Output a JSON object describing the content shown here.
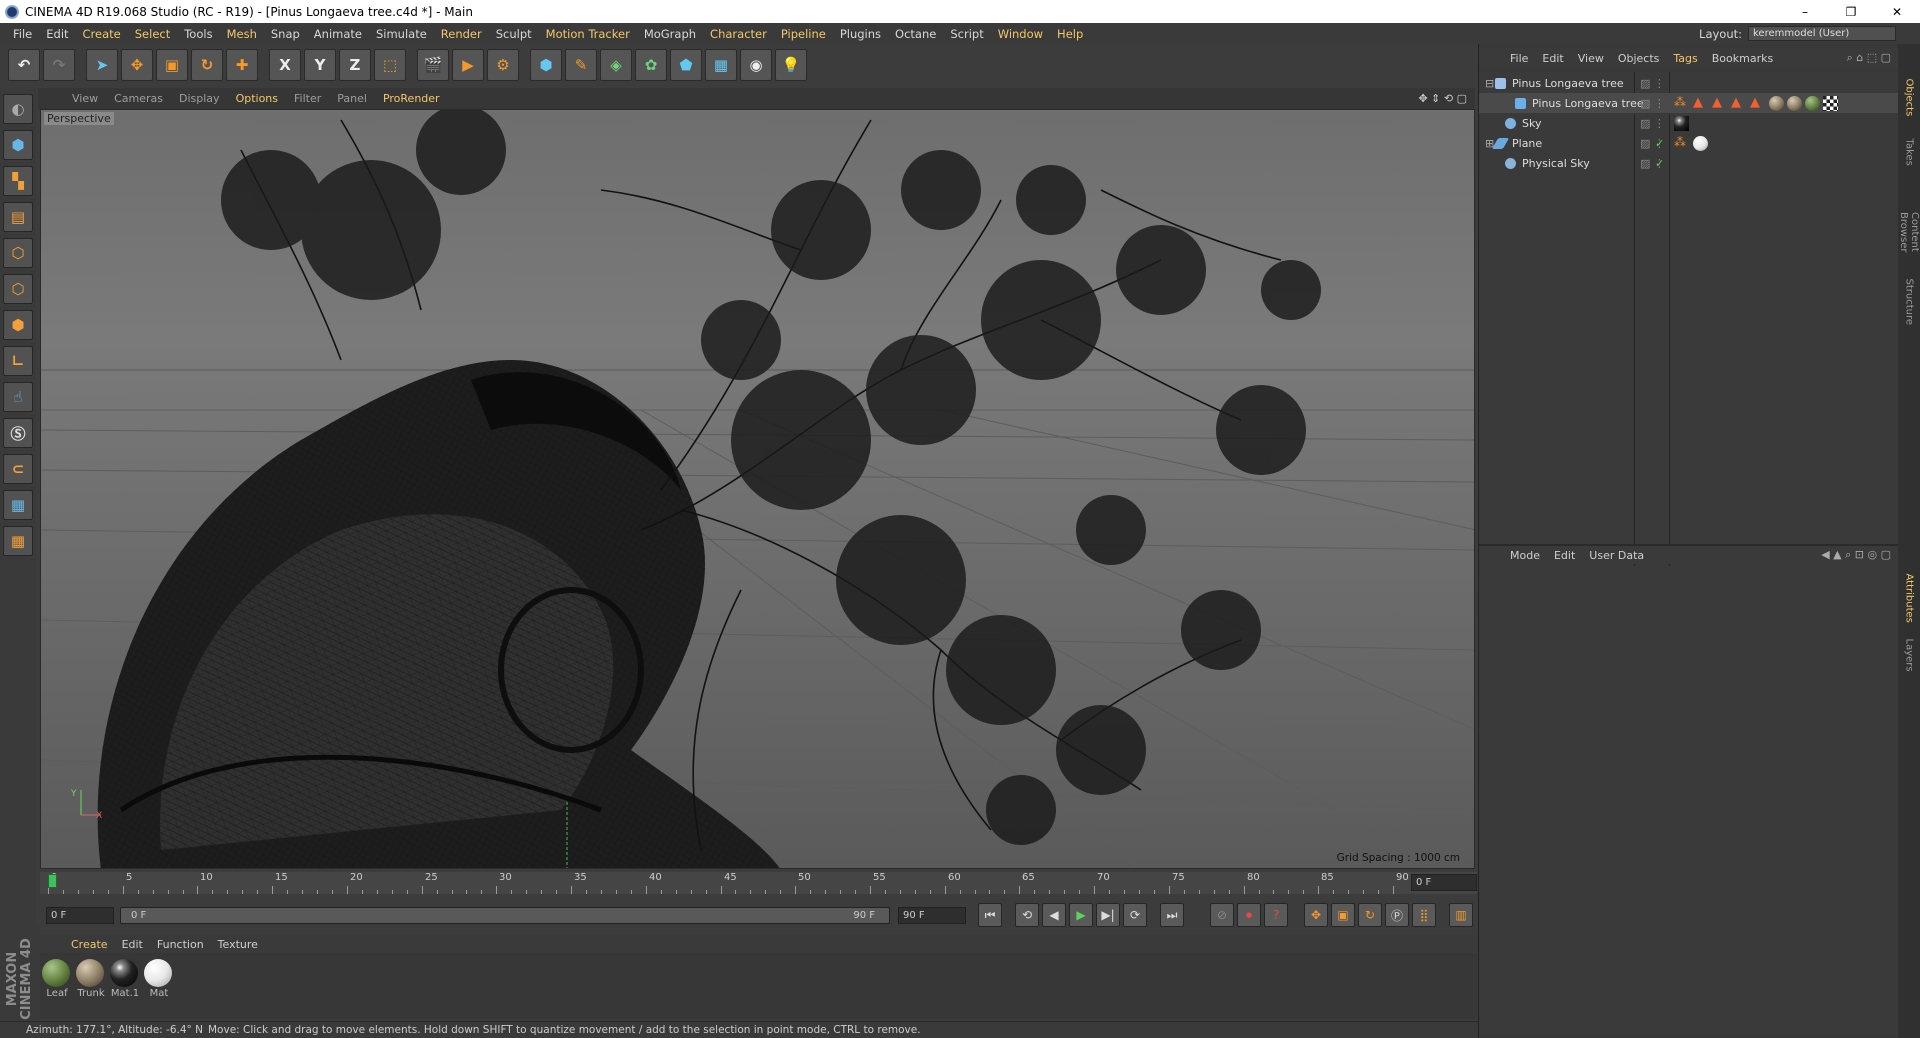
{
  "window": {
    "title": "CINEMA 4D R19.068 Studio (RC - R19) - [Pinus Longaeva tree.c4d *] - Main",
    "minimize": "–",
    "maximize": "❐",
    "close": "✕"
  },
  "menubar": {
    "items": [
      "File",
      "Edit",
      "Create",
      "Select",
      "Tools",
      "Mesh",
      "Snap",
      "Animate",
      "Simulate",
      "Render",
      "Sculpt",
      "Motion Tracker",
      "MoGraph",
      "Character",
      "Pipeline",
      "Plugins",
      "Octane",
      "Script",
      "Window",
      "Help"
    ],
    "layout_label": "Layout:",
    "layout_value": "keremmodel (User)"
  },
  "toolbar": {
    "undo": "↶",
    "redo": "↷",
    "axis_x": "X",
    "axis_y": "Y",
    "axis_z": "Z"
  },
  "viewport": {
    "menu": [
      "View",
      "Cameras",
      "Display",
      "Options",
      "Filter",
      "Panel",
      "ProRender"
    ],
    "label": "Perspective",
    "grid_spacing": "Grid Spacing : 1000 cm"
  },
  "timeline": {
    "ticks": [
      "0",
      "5",
      "10",
      "15",
      "20",
      "25",
      "30",
      "35",
      "40",
      "45",
      "50",
      "55",
      "60",
      "65",
      "70",
      "75",
      "80",
      "85",
      "90"
    ],
    "current_frame": "0 F"
  },
  "transport": {
    "start_field": "0 F",
    "slider_start": "0 F",
    "slider_end": "90 F",
    "end_field": "90 F"
  },
  "materials": {
    "tabs": [
      "Create",
      "Edit",
      "Function",
      "Texture"
    ],
    "items": [
      {
        "name": "Leaf",
        "color": "#5f7d3d"
      },
      {
        "name": "Trunk",
        "color": "#8a7a62"
      },
      {
        "name": "Mat.1",
        "color": "#222222"
      },
      {
        "name": "Mat",
        "color": "#e8e8e8"
      }
    ]
  },
  "brand": {
    "text": "MAXON CINEMA 4D"
  },
  "status": {
    "coords": "Azimuth: 177.1°, Altitude: -6.4°  N",
    "message": "Move: Click and drag to move elements. Hold down SHIFT to quantize movement / add to the selection in point mode, CTRL to remove."
  },
  "object_manager": {
    "menu": [
      "File",
      "Edit",
      "View",
      "Objects",
      "Tags",
      "Bookmarks"
    ],
    "objects": [
      {
        "name": "Pinus Longaeva tree",
        "color": "#9ec1ea"
      },
      {
        "name": "Pinus Longaeva tree",
        "color": "#6cb0e8"
      },
      {
        "name": "Sky",
        "color": "#7db2e0"
      },
      {
        "name": "Plane",
        "color": "#6aa8e0"
      },
      {
        "name": "Physical Sky",
        "color": "#87b4d8"
      }
    ]
  },
  "attributes": {
    "menu": [
      "Mode",
      "Edit",
      "User Data"
    ]
  },
  "side_tabs": [
    "Objects",
    "Takes",
    "Content Browser",
    "Structure",
    "Attributes",
    "Layers"
  ]
}
